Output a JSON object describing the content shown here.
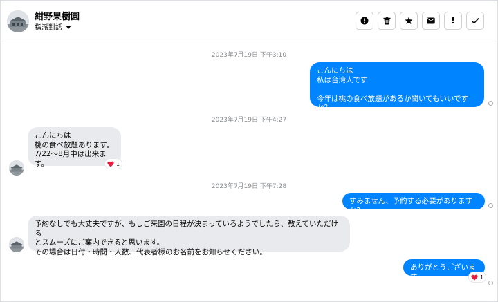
{
  "header": {
    "contact_name": "紺野果樹園",
    "assign_label": "指派對話",
    "toolbar_icons": [
      "alert-circle-icon",
      "trash-icon",
      "star-icon",
      "mail-icon",
      "exclamation-icon",
      "checkmark-icon"
    ],
    "exclamation_glyph": "!"
  },
  "colors": {
    "outgoing_bubble": "#0084ff",
    "incoming_bubble": "#e9eaed",
    "timestamp_text": "#8a8d91",
    "reaction_heart": "#e41e3f"
  },
  "messages": [
    {
      "timestamp": "2023年7月19日 下午3:10"
    },
    {
      "direction": "outgoing",
      "text": "こんにちは\n私は台湾人です\n\n今年は桃の食べ放題があるか聞いてもいいですか？"
    },
    {
      "timestamp": "2023年7月19日 下午4:27"
    },
    {
      "direction": "incoming",
      "text": "こんにちは\n桃の食べ放題あります。\n7/22～8月中は出来ます。",
      "reaction": {
        "icon": "heart-icon",
        "count": "1"
      }
    },
    {
      "timestamp": "2023年7月19日 下午7:28"
    },
    {
      "direction": "outgoing",
      "text": "すみません、予約する必要がありますか?"
    },
    {
      "direction": "incoming",
      "text": "予約なしでも大丈夫ですが、もしご来園の日程が決まっているようでしたら、教えていただける\nとスムーズにご案内できると思います。\nその場合は日付・時間・人数、代表者様のお名前をお知らせください。"
    },
    {
      "direction": "outgoing",
      "text": "ありがとうございます",
      "reaction": {
        "icon": "heart-icon",
        "count": "1"
      }
    }
  ]
}
